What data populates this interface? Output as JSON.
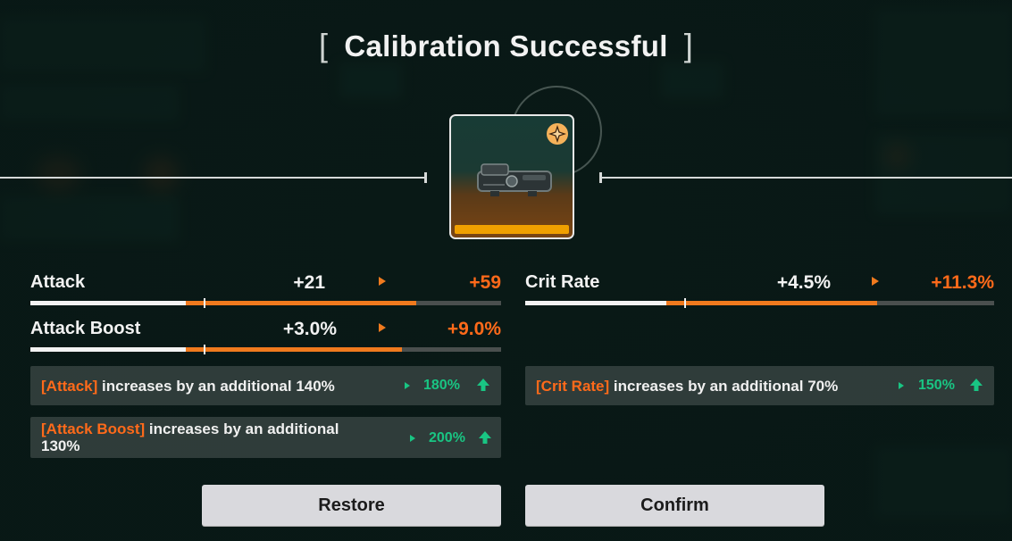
{
  "dialog": {
    "title": "Calibration Successful",
    "bracket_open": "[",
    "bracket_close": "]"
  },
  "item": {
    "icon": "scope-attachment-icon",
    "badge_icon": "four-point-star-icon",
    "rarity_color": "#f0a000"
  },
  "stats": [
    {
      "name": "Attack",
      "current": "+21",
      "next": "+59",
      "current_fill": 0.33,
      "next_fill": 0.82
    },
    {
      "name": "Attack Boost",
      "current": "+3.0%",
      "next": "+9.0%",
      "current_fill": 0.33,
      "next_fill": 0.79
    },
    {
      "name": "Crit Rate",
      "current": "+4.5%",
      "next": "+11.3%",
      "current_fill": 0.3,
      "next_fill": 0.75
    }
  ],
  "bonuses": [
    {
      "tag": "[Attack]",
      "text": " increases by an additional 140%",
      "value": "180%"
    },
    {
      "tag": "[Attack Boost]",
      "text": " increases by an additional 130%",
      "value": "200%"
    },
    {
      "tag": "[Crit Rate]",
      "text": " increases by an additional 70%",
      "value": "150%"
    }
  ],
  "buttons": {
    "restore": "Restore",
    "confirm": "Confirm"
  },
  "colors": {
    "accent_orange": "#ff6a1a",
    "bonus_green": "#19c583",
    "background": "#0b1a17"
  }
}
